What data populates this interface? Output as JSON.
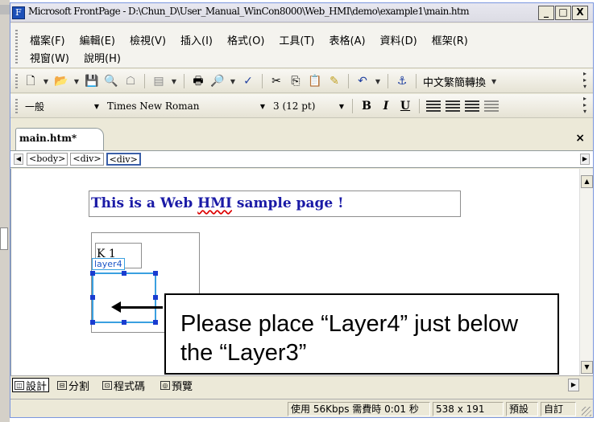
{
  "window": {
    "title": "Microsoft FrontPage - D:\\Chun_D\\User_Manual_WinCon8000\\Web_HMI\\demo\\example1\\main.htm",
    "app_icon": "frontpage-icon",
    "buttons": [
      "_",
      "□",
      "X"
    ]
  },
  "menu": {
    "row1": [
      "檔案(F)",
      "編輯(E)",
      "檢視(V)",
      "插入(I)",
      "格式(O)",
      "工具(T)",
      "表格(A)",
      "資料(D)",
      "框架(R)"
    ],
    "row2": [
      "視窗(W)",
      "說明(H)"
    ]
  },
  "toolbar": {
    "chinese_convert_label": "中文繁簡轉換",
    "style_value": "一般",
    "font_value": "Times New Roman",
    "size_value": "3  (12 pt)",
    "bold": "B",
    "italic": "I",
    "underline": "U"
  },
  "doc_tab": {
    "label": "main.htm*",
    "close": "×"
  },
  "tag_selector": {
    "tags": [
      "<body>",
      "<div>",
      "<div>"
    ],
    "active_index": 2
  },
  "editor": {
    "heading_prefix": "This is a Web ",
    "heading_squiggle": "HMI",
    "heading_suffix": " sample page !",
    "k1_text": "K 1",
    "layer4_label": "layer4"
  },
  "callout": {
    "text": "Please place “Layer4” just below the “Layer3”"
  },
  "view_tabs": {
    "design": "設計",
    "split": "分割",
    "code": "程式碼",
    "preview": "預覽"
  },
  "status": {
    "download": "使用 56Kbps 需費時 0:01 秒",
    "dimensions": "538 x 191",
    "mode": "預設",
    "custom": "自訂"
  }
}
